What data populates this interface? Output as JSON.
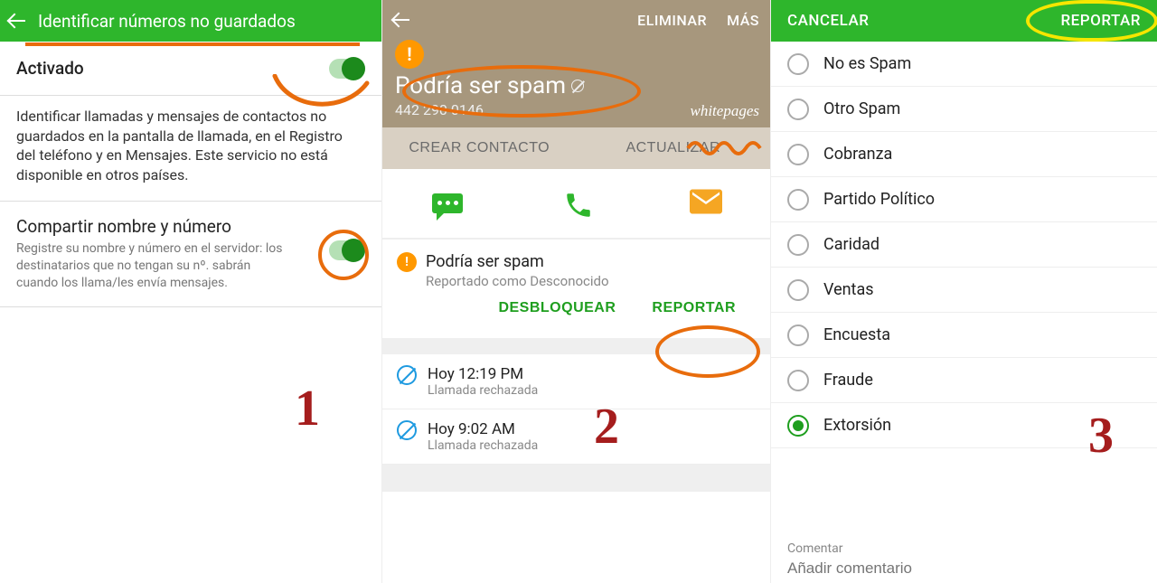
{
  "panel1": {
    "title": "Identificar números no guardados",
    "activated_label": "Activado",
    "description": "Identificar llamadas y mensajes de contactos no guardados en la pantalla de llamada, en el Registro del teléfono y en Mensajes. Este servicio no está disponible en otros países.",
    "share_title": "Compartir nombre y número",
    "share_desc": "Registre su nombre y número en el servidor: los destinatarios que no tengan su nº. sabrán cuando los llama/les envía mensajes.",
    "step_number": "1"
  },
  "panel2": {
    "delete": "ELIMINAR",
    "more": "MÁS",
    "spam_title": "Podría ser spam",
    "phone": "442 290 0146",
    "provider": "whitepages",
    "create_contact": "CREAR CONTACTO",
    "update": "ACTUALIZAR",
    "card_title": "Podría ser spam",
    "card_sub": "Reportado como Desconocido",
    "unblock": "DESBLOQUEAR",
    "report": "REPORTAR",
    "calls": [
      {
        "time": "Hoy 12:19 PM",
        "status": "Llamada rechazada"
      },
      {
        "time": "Hoy 9:02 AM",
        "status": "Llamada rechazada"
      }
    ],
    "step_number": "2"
  },
  "panel3": {
    "cancel": "CANCELAR",
    "report": "REPORTAR",
    "options": [
      {
        "label": "No es Spam",
        "checked": false
      },
      {
        "label": "Otro Spam",
        "checked": false
      },
      {
        "label": "Cobranza",
        "checked": false
      },
      {
        "label": "Partido Político",
        "checked": false
      },
      {
        "label": "Caridad",
        "checked": false
      },
      {
        "label": "Ventas",
        "checked": false
      },
      {
        "label": "Encuesta",
        "checked": false
      },
      {
        "label": "Fraude",
        "checked": false
      },
      {
        "label": "Extorsión",
        "checked": true
      }
    ],
    "comment_label": "Comentar",
    "comment_placeholder": "Añadir comentario",
    "step_number": "3"
  }
}
